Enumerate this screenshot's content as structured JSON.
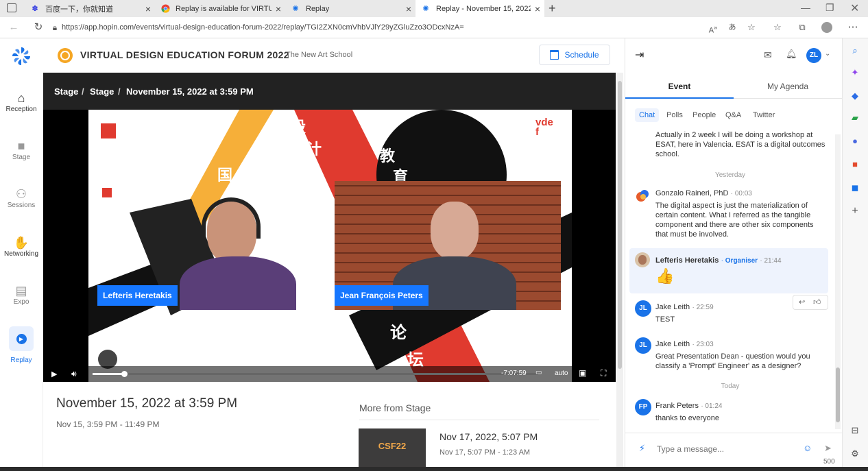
{
  "browser": {
    "tabs": [
      {
        "title": "百度一下，你就知道",
        "icon": "baidu-paw-icon"
      },
      {
        "title": "Replay is available for VIRTUAL D",
        "icon": "chrome-icon"
      },
      {
        "title": "Replay",
        "icon": "hopin-icon"
      },
      {
        "title": "Replay - November 15, 2022 at 3",
        "icon": "hopin-icon"
      }
    ],
    "url": "https://app.hopin.com/events/virtual-design-education-forum-2022/replay/TGI2ZXN0cmVhbVJlY29yZGluZzo3ODcxNzA="
  },
  "leftnav": {
    "items": [
      {
        "label": "Reception",
        "icon": "home-icon"
      },
      {
        "label": "Stage",
        "icon": "video-camera-icon"
      },
      {
        "label": "Sessions",
        "icon": "people-group-icon"
      },
      {
        "label": "Networking",
        "icon": "handshake-icon"
      },
      {
        "label": "Expo",
        "icon": "booth-icon"
      },
      {
        "label": "Replay",
        "icon": "play-circle-icon"
      }
    ]
  },
  "header": {
    "event_title": "VIRTUAL DESIGN EDUCATION FORUM 2022",
    "organizer": "The New Art School",
    "schedule_label": "Schedule"
  },
  "video": {
    "breadcrumb": [
      "Stage",
      "Stage",
      "November 15, 2022 at 3:59 PM"
    ],
    "speaker_left": "Lefteris Heretakis",
    "speaker_right": "Jean François Peters",
    "time_remaining": "-7:07:59",
    "quality": "auto",
    "progress": 0.07
  },
  "below": {
    "title": "November 15, 2022 at 3:59 PM",
    "subtitle": "Nov 15, 3:59 PM - 11:49 PM",
    "more_from": "More from Stage",
    "next_thumb_text": "CSF22",
    "next_title": "Nov 17, 2022, 5:07 PM",
    "next_subtitle": "Nov 17, 5:07 PM - 1:23 AM"
  },
  "panel": {
    "user_initials": "ZL",
    "tabs": [
      "Event",
      "My Agenda"
    ],
    "chips": [
      "Chat",
      "Polls",
      "People",
      "Q&A",
      "Twitter"
    ],
    "first_msg": "Actually in 2 week I will be doing a workshop at ESAT, here in Valencia. ESAT is a digital outcomes school.",
    "divider_yesterday": "Yesterday",
    "divider_today": "Today",
    "messages": [
      {
        "name": "Gonzalo Raineri, PhD",
        "time": "00:03",
        "body": "The digital aspect is just the materialization of certain content. What I referred as the tangible component and there are other six components that must be involved."
      },
      {
        "name": "Lefteris Heretakis",
        "role": "Organiser",
        "time": "21:44",
        "body": "👍"
      },
      {
        "name": "Jake Leith",
        "initials": "JL",
        "time": "22:59",
        "body": "TEST"
      },
      {
        "name": "Jake Leith",
        "initials": "JL",
        "time": "23:03",
        "body": "Great Presentation Dean - question would you classify a 'Prompt' Engineer' as a designer?"
      },
      {
        "name": "Frank Peters",
        "initials": "FP",
        "time": "01:24",
        "body": "thanks to everyone"
      }
    ],
    "input_placeholder": "Type a message...",
    "char_limit": "500"
  },
  "colors": {
    "accent": "#1a73e8",
    "tag_blue": "#1677ff",
    "poster_red": "#e03a2f"
  }
}
